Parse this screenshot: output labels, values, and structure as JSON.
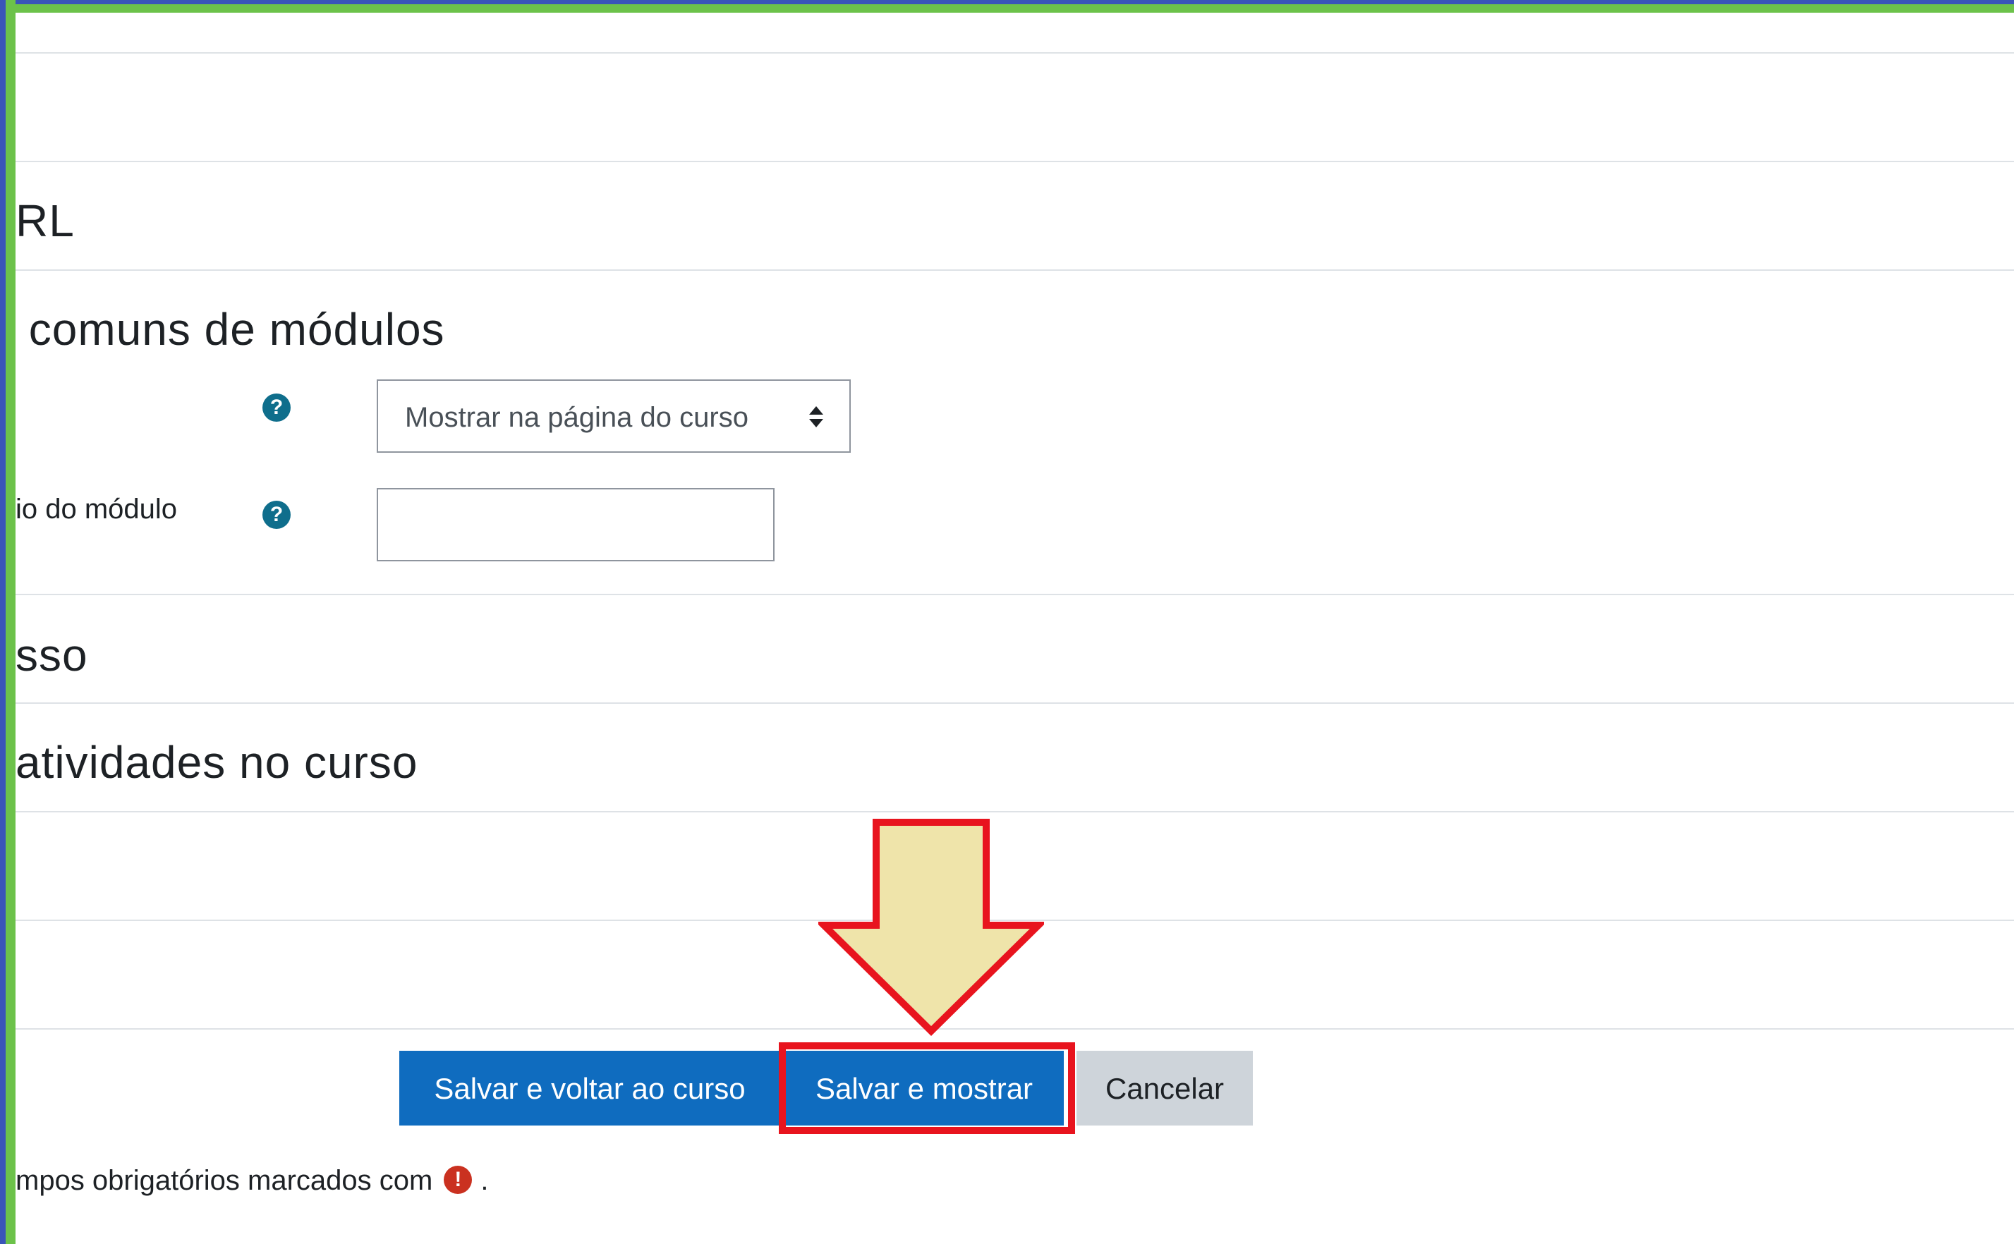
{
  "sections": {
    "url_heading": "RL",
    "common_modules_heading": " comuns de módulos",
    "access_heading": "sso",
    "activities_heading": "atividades no curso"
  },
  "form": {
    "availability_select_value": "Mostrar na página do curso",
    "id_number_label": "io do módulo",
    "id_number_value": "",
    "help_icon_glyph": "?"
  },
  "actions": {
    "save_return_label": "Salvar e voltar ao curso",
    "save_display_label": "Salvar e mostrar",
    "cancel_label": "Cancelar"
  },
  "footer": {
    "required_text": "mpos obrigatórios marcados com",
    "required_icon_glyph": "!",
    "trailing_period": "."
  },
  "annotation": {
    "arrow_icon": "down-arrow-icon",
    "arrow_fill": "#efe4aa",
    "highlight_color": "#e8141e"
  },
  "theme": {
    "primary": "#0f6cbf",
    "secondary": "#ced4da",
    "help_icon_color": "#0f6e8c",
    "required_icon_color": "#ca3120",
    "frame_green": "#6cc24a",
    "frame_blue": "#3a55b8"
  }
}
